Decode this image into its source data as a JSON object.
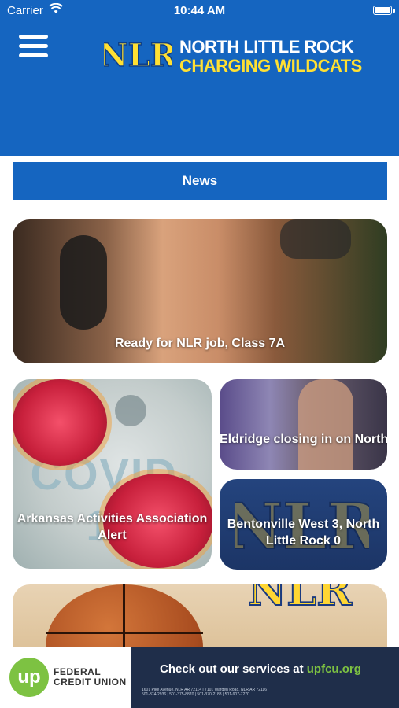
{
  "status_bar": {
    "carrier": "Carrier",
    "time": "10:44 AM"
  },
  "header": {
    "logo_text": "NLR",
    "brand_line1": "NORTH LITTLE ROCK",
    "brand_line2": "CHARGING WILDCATS",
    "colors": {
      "primary": "#1565c0",
      "accent": "#ffe033"
    }
  },
  "news_button": {
    "label": "News"
  },
  "news_cards": [
    {
      "title": "Ready for NLR job, Class 7A"
    },
    {
      "title": "Arkansas Activities Association Alert",
      "bg_text": "COVID-19"
    },
    {
      "title": "Eldridge closing in on North Little Rock coac..."
    },
    {
      "title": "Bentonville West 3, North Little Rock 0"
    },
    {
      "title": ""
    }
  ],
  "ad_banner": {
    "logo": "up",
    "org_line1": "FEDERAL",
    "org_line2": "CREDIT UNION",
    "message": "Check out our services at ",
    "url": "upfcu.org",
    "fine_print1": "1601 Pike Avenue, NLR AR 72114 | 7101 Warden Road, NLR AR 72116",
    "fine_print2": "501-374-2936 | 501-375-8870 | 501-370-2188 | 501-907-7270"
  }
}
